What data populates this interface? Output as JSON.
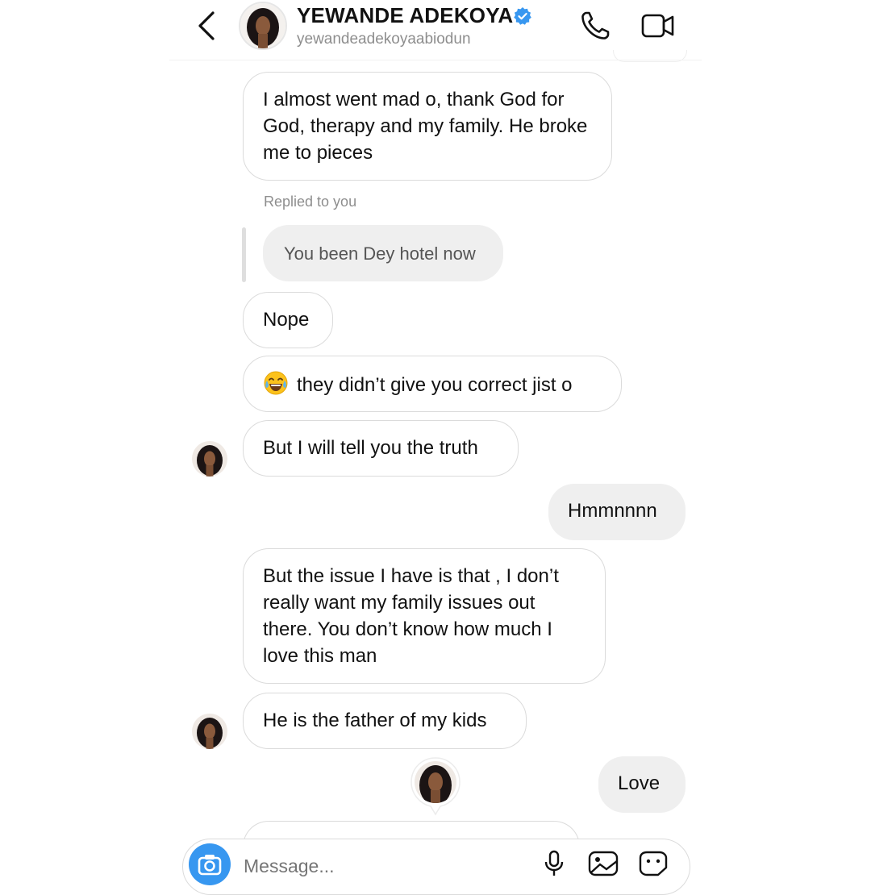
{
  "header": {
    "display_name": "YEWANDE ADEKOYA",
    "username": "yewandeadekoyaabiodun",
    "verified": true,
    "icons": [
      "chevron-left-icon",
      "verified-badge-icon",
      "phone-icon",
      "video-camera-icon"
    ]
  },
  "messages": {
    "m1": "I almost went mad o, thank God for God, therapy and my family. He broke me to pieces",
    "reply_label": "Replied to you",
    "quoted": "You been Dey hotel now",
    "m2": "Nope",
    "m3": "they didn’t give you correct jist o",
    "m4": "But I will tell you the truth",
    "m5": "Hmmnnnn",
    "m6": "But the issue I have is that , I don’t really want my family issues out there. You don’t know how much I love this man",
    "m7": "He is the father of my kids",
    "m8": "Love"
  },
  "composer": {
    "placeholder": "Message..."
  },
  "colors": {
    "accent": "#3797f0",
    "incoming_border": "#dbdbdb",
    "outgoing_bg": "#efefef",
    "verified": "#3897f0"
  }
}
